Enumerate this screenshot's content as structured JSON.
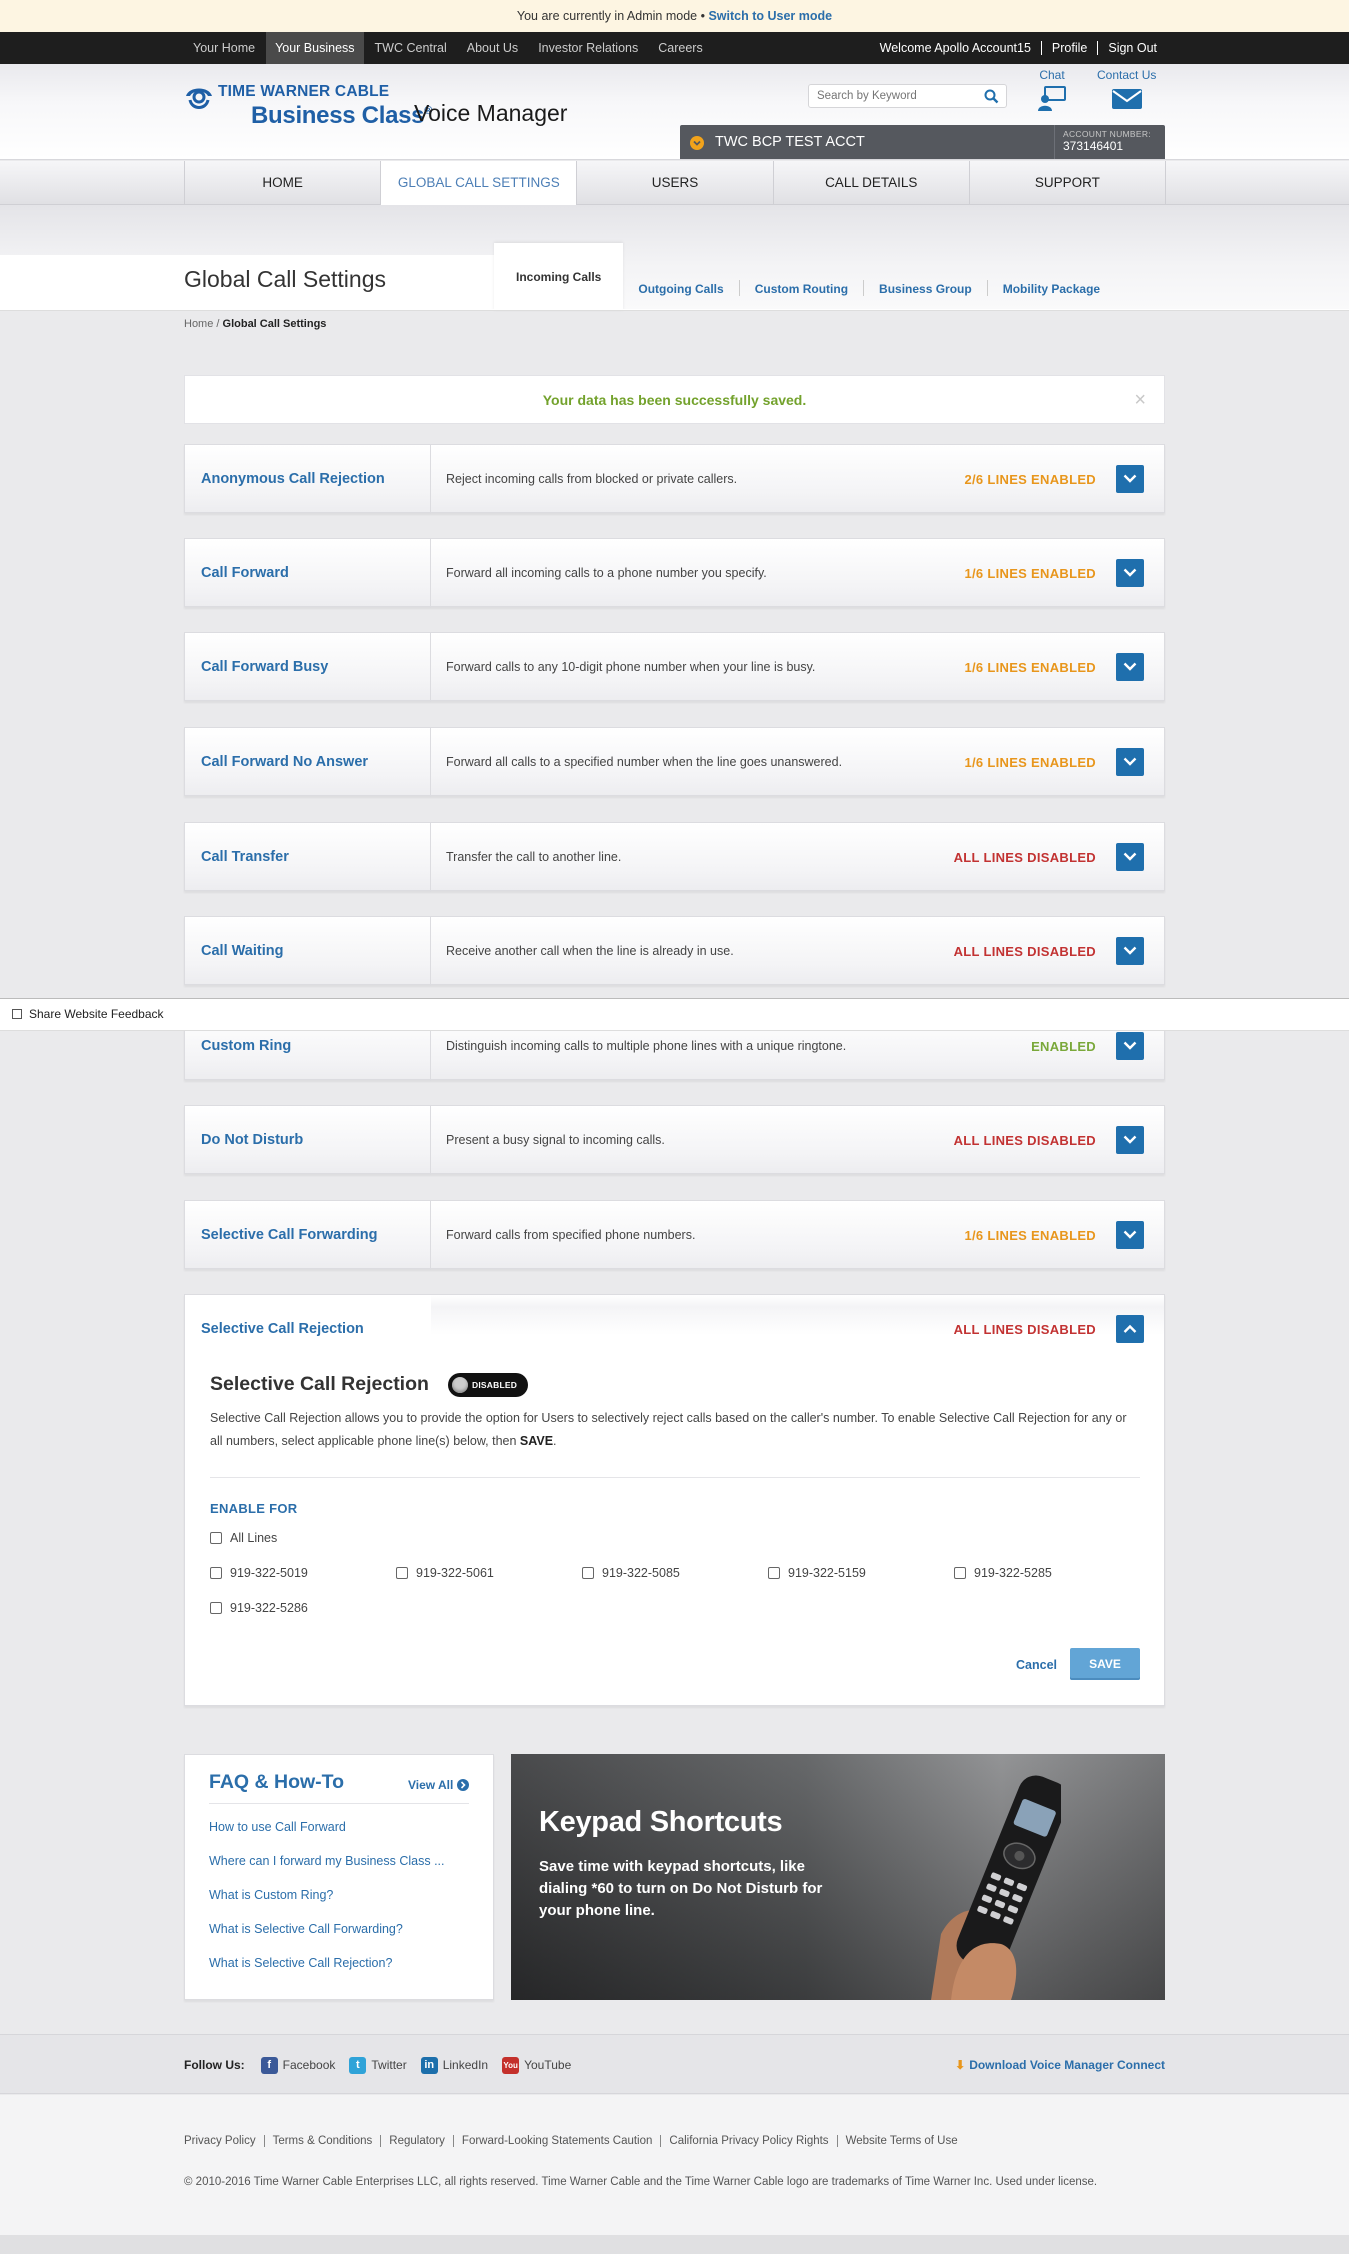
{
  "admin_bar": {
    "text": "You are currently in Admin mode •",
    "link": "Switch to User mode"
  },
  "top_nav": {
    "items": [
      {
        "label": "Your Home",
        "active": false
      },
      {
        "label": "Your Business",
        "active": true
      },
      {
        "label": "TWC Central",
        "active": false
      },
      {
        "label": "About Us",
        "active": false
      },
      {
        "label": "Investor Relations",
        "active": false
      },
      {
        "label": "Careers",
        "active": false
      }
    ],
    "welcome": "Welcome Apollo Account15",
    "profile": "Profile",
    "sign_out": "Sign Out"
  },
  "header": {
    "logo_line1": "TIME WARNER CABLE",
    "logo_line2": "Business Class",
    "logo_reg": "®",
    "product_title": "Voice Manager",
    "search_placeholder": "Search by Keyword",
    "chat_label": "Chat",
    "contact_label": "Contact Us",
    "account_name": "TWC BCP TEST ACCT",
    "account_number_label": "ACCOUNT NUMBER:",
    "account_number": "373146401"
  },
  "main_nav": [
    {
      "label": "HOME",
      "active": false
    },
    {
      "label": "GLOBAL CALL SETTINGS",
      "active": true
    },
    {
      "label": "USERS",
      "active": false
    },
    {
      "label": "CALL DETAILS",
      "active": false
    },
    {
      "label": "SUPPORT",
      "active": false
    }
  ],
  "page": {
    "title": "Global Call Settings",
    "sub_tabs": [
      {
        "label": "Incoming Calls",
        "active": true
      },
      {
        "label": "Outgoing Calls",
        "active": false
      },
      {
        "label": "Custom Routing",
        "active": false
      },
      {
        "label": "Business Group",
        "active": false
      },
      {
        "label": "Mobility Package",
        "active": false
      }
    ],
    "breadcrumb_home": "Home",
    "breadcrumb_sep": " / ",
    "breadcrumb_current": "Global Call Settings"
  },
  "success_message": "Your data has been successfully saved.",
  "features": [
    {
      "name": "Anonymous Call Rejection",
      "desc": "Reject incoming calls from blocked or private callers.",
      "status": "2/6 LINES ENABLED",
      "status_type": "orange"
    },
    {
      "name": "Call Forward",
      "desc": "Forward all incoming calls to a phone number you specify.",
      "status": "1/6 LINES ENABLED",
      "status_type": "orange"
    },
    {
      "name": "Call Forward Busy",
      "desc": "Forward calls to any 10-digit phone number when your line is busy.",
      "status": "1/6 LINES ENABLED",
      "status_type": "orange"
    },
    {
      "name": "Call Forward No Answer",
      "desc": "Forward all calls to a specified number when the line goes unanswered.",
      "status": "1/6 LINES ENABLED",
      "status_type": "orange"
    },
    {
      "name": "Call Transfer",
      "desc": "Transfer the call to another line.",
      "status": "ALL LINES DISABLED",
      "status_type": "red"
    },
    {
      "name": "Call Waiting",
      "desc": "Receive another call when the line is already in use.",
      "status": "ALL LINES DISABLED",
      "status_type": "red"
    },
    {
      "name": "Custom Ring",
      "desc": "Distinguish incoming calls to multiple phone lines with a unique ringtone.",
      "status": "ENABLED",
      "status_type": "green"
    },
    {
      "name": "Do Not Disturb",
      "desc": "Present a busy signal to incoming calls.",
      "status": "ALL LINES DISABLED",
      "status_type": "red"
    },
    {
      "name": "Selective Call Forwarding",
      "desc": "Forward calls from specified phone numbers.",
      "status": "1/6 LINES ENABLED",
      "status_type": "orange"
    }
  ],
  "feedback_label": "Share Website Feedback",
  "expanded": {
    "name": "Selective Call Rejection",
    "status": "ALL LINES DISABLED",
    "title": "Selective Call Rejection",
    "toggle_label": "DISABLED",
    "desc_main": "Selective Call Rejection allows you to provide the option for Users to selectively reject calls based on the caller's number. To enable Selective Call Rejection for any or all numbers, select applicable phone line(s) below, then",
    "desc_bold": "SAVE",
    "desc_end": ".",
    "enable_for": "ENABLE FOR",
    "all_lines": "All Lines",
    "lines": [
      "919-322-5019",
      "919-322-5061",
      "919-322-5085",
      "919-322-5159",
      "919-322-5285",
      "919-322-5286"
    ],
    "cancel": "Cancel",
    "save": "SAVE"
  },
  "faq": {
    "title": "FAQ & How-To",
    "view_all": "View All",
    "questions": [
      "How to use Call Forward",
      "Where can I forward my Business Class ...",
      "What is Custom Ring?",
      "What is Selective Call Forwarding?",
      "What is Selective Call Rejection?"
    ]
  },
  "promo": {
    "title": "Keypad Shortcuts",
    "desc": "Save time with keypad shortcuts, like dialing *60 to turn on Do Not Disturb for your phone line."
  },
  "follow": {
    "label": "Follow Us:",
    "networks": [
      "Facebook",
      "Twitter",
      "LinkedIn",
      "YouTube"
    ],
    "download": "Download Voice Manager Connect"
  },
  "footer": {
    "links": [
      "Privacy Policy",
      "Terms & Conditions",
      "Regulatory",
      "Forward-Looking Statements Caution",
      "California Privacy Policy Rights",
      "Website Terms of Use"
    ],
    "copyright": "© 2010-2016 Time Warner Cable Enterprises LLC, all rights reserved. Time Warner Cable and the Time Warner Cable logo are trademarks of Time Warner Inc. Used under license."
  },
  "colors": {
    "brand_blue": "#2b6eaa",
    "orange": "#e8961c",
    "red": "#c23232",
    "green": "#7aa83a",
    "success_green": "#73a22c"
  }
}
